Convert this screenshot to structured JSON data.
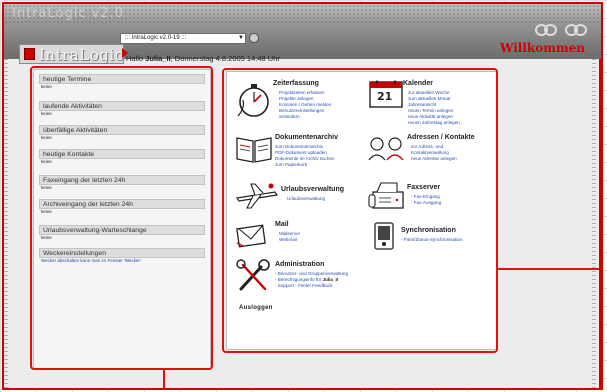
{
  "header": {
    "ghost_title": "IntraLogic v2.0",
    "logo_text": "IntraLogic",
    "select_value": "::: IntraLogic v2.0-19 :::",
    "greeting_prefix": "Hallo ",
    "user_name": "Julia_II",
    "greeting_suffix": ", Donnerstag 4.8.2005 14:48 Uhr",
    "welcome": "Willkommen"
  },
  "sidebar": {
    "sections": [
      {
        "title": "heutige Termine",
        "body": "keine"
      },
      {
        "title": "laufende Aktivitäten",
        "body": "keine"
      },
      {
        "title": "überfällige Aktivitäten",
        "body": "keine"
      },
      {
        "title": "heutige Kontakte",
        "body": "keine"
      },
      {
        "title": "Faxeingang der letzten 24h",
        "body": "keine"
      },
      {
        "title": "Archiveingang der letzten 24h",
        "body": "keine"
      },
      {
        "title": "Urlaubsverwaltung-Warteschlange",
        "body": "keine"
      },
      {
        "title": "Weckereinstellungen",
        "body": "Wecker abschalten kann man im Fenster 'Wecker'"
      }
    ]
  },
  "modules": {
    "zeiterfassung": {
      "title": "Zeiterfassung",
      "links": [
        "Projektzeiten erfassen",
        "Projekte anlegen",
        "Kommen / Gehen melden",
        "Benutzereinstellungen",
        "verändern"
      ],
      "icon": "stopwatch-icon"
    },
    "kalender": {
      "title": "Kalender",
      "links": [
        "zur aktuellen Woche",
        "zum aktuellen Monat",
        "Jahresansicht",
        "neuen Termin anlegen",
        "neue Aktivität anlegen",
        "neuen Jahrestag anlegen"
      ],
      "icon": "calendar-icon",
      "calendar_day": "21"
    },
    "dokumentenarchiv": {
      "title": "Dokumentenarchiv",
      "links": [
        "zum Dokumentenarchiv",
        "PDF-Dokument uploaden",
        "Dokumente im Archiv suchen",
        "zum Papierkorb"
      ],
      "icon": "book-icon"
    },
    "adressen": {
      "title": "Adressen / Kontakte",
      "links": [
        "zur Adress- und",
        "Kontaktverwaltung",
        "neue Adresse anlegen"
      ],
      "icon": "people-icon"
    },
    "urlaub": {
      "title": "Urlaubsverwaltung",
      "links": [
        "Urlaubsverwaltung"
      ],
      "icon": "airplane-icon"
    },
    "faxserver": {
      "title": "Faxserver",
      "links": [
        "- Fax-Eingang",
        "- Fax-Ausgang"
      ],
      "icon": "fax-icon"
    },
    "mail": {
      "title": "Mail",
      "links": [
        "Mailserver",
        "Webmail"
      ],
      "icon": "mail-icon"
    },
    "synchronisation": {
      "title": "Synchronisation",
      "links": [
        "- Palm/Ziarus-Synchronisation"
      ],
      "icon": "pda-icon"
    },
    "administration": {
      "title": "Administration",
      "links": [
        "- Benutzer- und Gruppenverwaltung",
        "- Berechtigungsinfo für ",
        "- Support - Fehler Feedback"
      ],
      "user_bold": "Julia_II",
      "icon": "tools-icon"
    }
  },
  "logout_label": "Ausloggen",
  "colors": {
    "accent": "#d00000",
    "link": "#2a4fb0"
  }
}
